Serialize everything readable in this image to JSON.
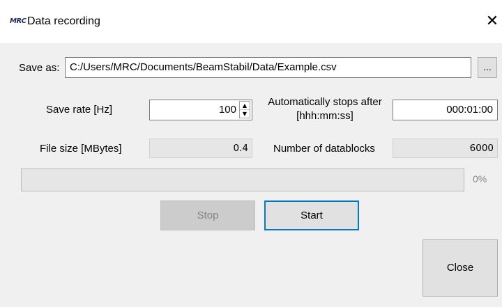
{
  "window": {
    "app_icon_text": "MRC",
    "title": "Data recording",
    "close_glyph": "✕"
  },
  "save_as": {
    "label": "Save as:",
    "path": "C:/Users/MRC/Documents/BeamStabil/Data/Example.csv",
    "browse_label": "..."
  },
  "save_rate": {
    "label": "Save rate [Hz]",
    "value": "100",
    "up_glyph": "▲",
    "down_glyph": "▼"
  },
  "auto_stop": {
    "label_line1": "Automatically stops after",
    "label_line2": "[hhh:mm:ss]",
    "value": "000:01:00"
  },
  "file_size": {
    "label": "File size [MBytes]",
    "value": "0.4"
  },
  "datablocks": {
    "label": "Number of datablocks",
    "value": "6000"
  },
  "progress": {
    "value": 0,
    "text": "0%"
  },
  "buttons": {
    "stop": "Stop",
    "start": "Start",
    "close": "Close"
  }
}
